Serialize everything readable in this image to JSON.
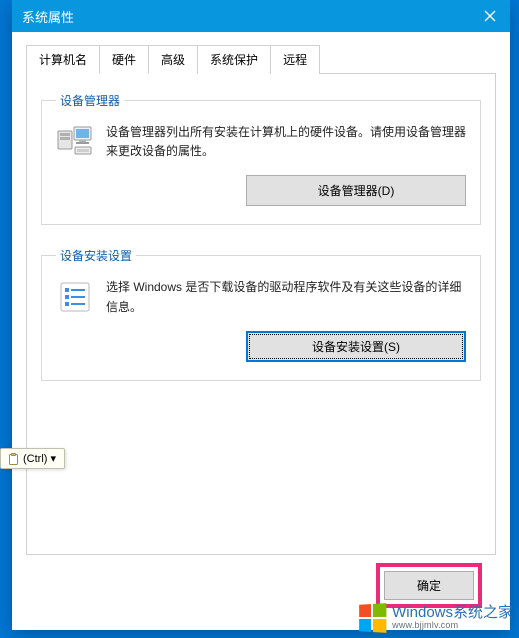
{
  "window": {
    "title": "系统属性"
  },
  "tabs": {
    "computer_name": "计算机名",
    "hardware": "硬件",
    "advanced": "高级",
    "system_protection": "系统保护",
    "remote": "远程"
  },
  "device_manager": {
    "legend": "设备管理器",
    "desc": "设备管理器列出所有安装在计算机上的硬件设备。请使用设备管理器来更改设备的属性。",
    "button": "设备管理器(D)"
  },
  "device_install": {
    "legend": "设备安装设置",
    "desc": "选择 Windows 是否下载设备的驱动程序软件及有关这些设备的详细信息。",
    "button": "设备安装设置(S)"
  },
  "footer": {
    "ok": "确定"
  },
  "tooltip": {
    "ctrl": "(Ctrl) ▾"
  },
  "watermark": {
    "main": "Windows系统之家",
    "sub": "www.bjjmlv.com"
  }
}
